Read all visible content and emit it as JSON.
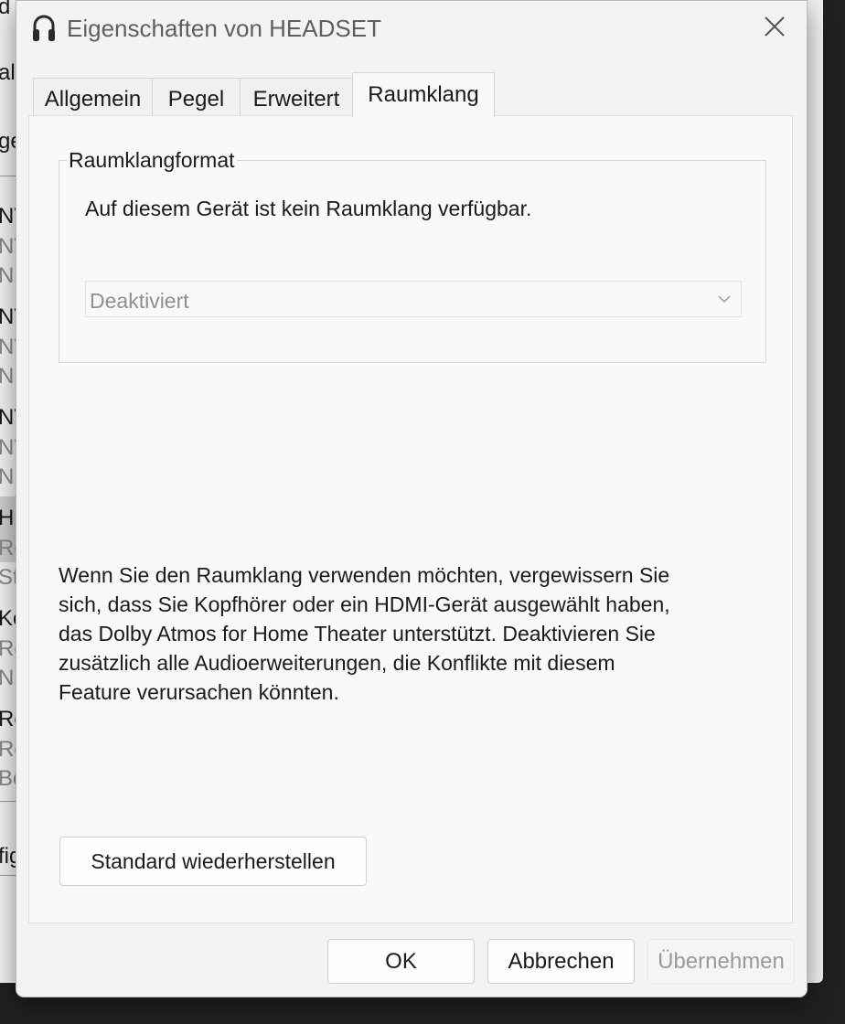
{
  "background_window": {
    "fragments": [
      "d",
      "al",
      "ge",
      "NV",
      "NV",
      "Ni",
      "NV",
      "NV",
      "Ni",
      "NV",
      "NV",
      "Ni",
      "HE",
      "Re",
      "Sta",
      "Ko",
      "Re",
      "Ni",
      "Re",
      "Re",
      "Be",
      "fig"
    ]
  },
  "dialog": {
    "title": "Eigenschaften von HEADSET",
    "title_icon": "headphones-icon",
    "close_icon": "close-icon"
  },
  "tabs": [
    {
      "label": "Allgemein",
      "active": false
    },
    {
      "label": "Pegel",
      "active": false
    },
    {
      "label": "Erweitert",
      "active": false
    },
    {
      "label": "Raumklang",
      "active": true
    }
  ],
  "spatial": {
    "group_title": "Raumklangformat",
    "message": "Auf diesem Gerät ist kein Raumklang verfügbar.",
    "format_select": {
      "value": "Deaktiviert",
      "disabled": true
    },
    "info_text": "Wenn Sie den Raumklang verwenden möchten, vergewissern Sie sich, dass Sie Kopfhörer oder ein HDMI-Gerät ausgewählt haben, das Dolby Atmos for Home Theater unterstützt. Deaktivieren Sie zusätzlich alle Audioerweiterungen, die Konflikte mit diesem Feature verursachen könnten.",
    "info_lines": [
      "Wenn Sie den Raumklang verwenden möchten, vergewissern Sie",
      "sich, dass Sie Kopfhörer oder ein HDMI-Gerät ausgewählt haben,",
      "das Dolby Atmos for Home Theater unterstützt. Deaktivieren Sie",
      "zusätzlich alle Audioerweiterungen, die Konflikte mit diesem",
      "Feature verursachen könnten."
    ],
    "restore_label": "Standard wiederherstellen"
  },
  "footer": {
    "ok_label": "OK",
    "cancel_label": "Abbrechen",
    "apply_label": "Übernehmen",
    "apply_disabled": true
  },
  "colors": {
    "dialog_bg": "#f3f3f3",
    "panel_bg": "#f9f9f9",
    "disabled_text": "#8f8f8f",
    "desktop_bg": "#202020"
  }
}
